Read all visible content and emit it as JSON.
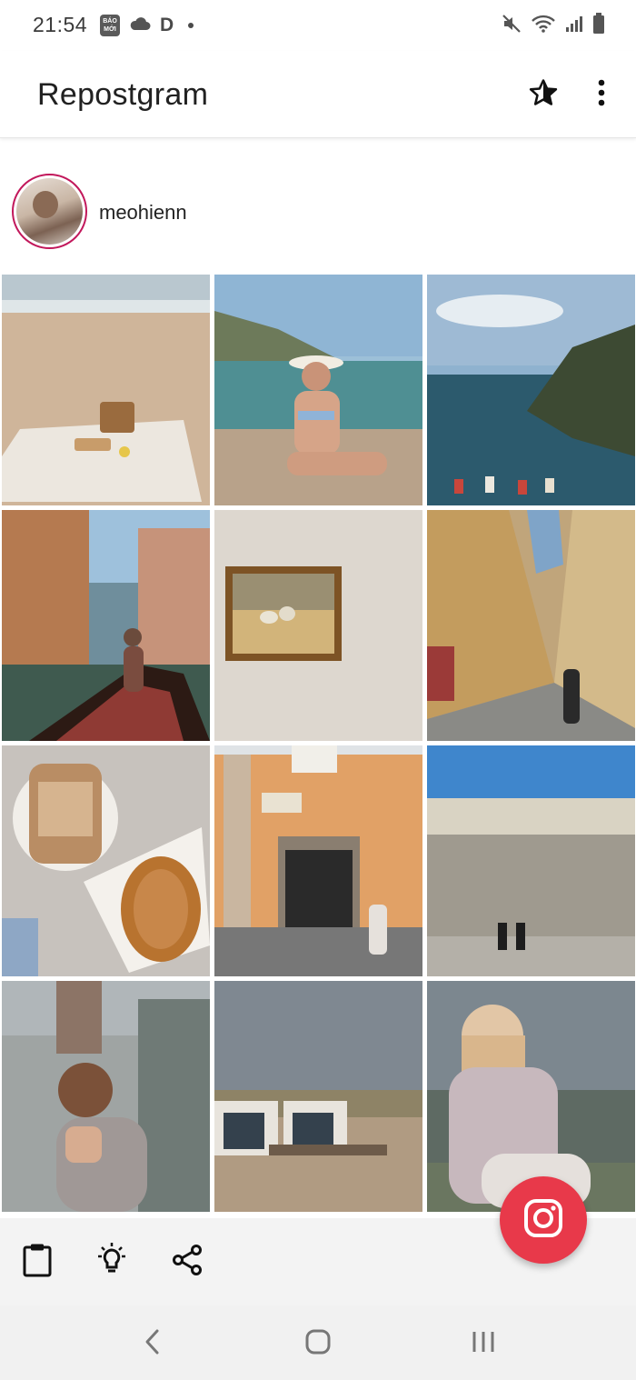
{
  "status_bar": {
    "time": "21:54",
    "left_icons": [
      "baomoi-icon",
      "cloud-icon",
      "d-icon",
      "dot-icon"
    ],
    "baomoi_label": "BÁO MỚI",
    "d_label": "D",
    "right_icons": [
      "mute-icon",
      "wifi-icon",
      "signal-icon",
      "battery-icon"
    ]
  },
  "app_bar": {
    "title": "Repostgram",
    "actions": [
      "favorite-star-icon",
      "more-vert-icon"
    ]
  },
  "profile": {
    "username": "meohienn",
    "avatar_border_color": "#c2185b"
  },
  "grid": {
    "columns": 3,
    "posts": [
      {
        "subject": "beach picnic"
      },
      {
        "subject": "woman on beach with sun hat"
      },
      {
        "subject": "coastal cliffs with boats"
      },
      {
        "subject": "venice gondola"
      },
      {
        "subject": "framed painting on wall"
      },
      {
        "subject": "florence street"
      },
      {
        "subject": "iced coffee and croissant"
      },
      {
        "subject": "orange building cafe"
      },
      {
        "subject": "san marco square"
      },
      {
        "subject": "portrait woman hand in hair"
      },
      {
        "subject": "beach huts in dunes"
      },
      {
        "subject": "woman sitting portrait"
      }
    ]
  },
  "bottom_toolbar": {
    "tools": [
      "clipboard-icon",
      "lightbulb-icon",
      "share-icon"
    ],
    "fab_icon": "instagram-icon",
    "fab_color": "#e8394a"
  },
  "nav_bar": {
    "buttons": [
      "back-icon",
      "home-icon",
      "recents-icon"
    ]
  },
  "colors": {
    "accent": "#e8394a",
    "toolbar_bg": "#f3f3f3",
    "nav_bg": "#f1f1f1"
  }
}
